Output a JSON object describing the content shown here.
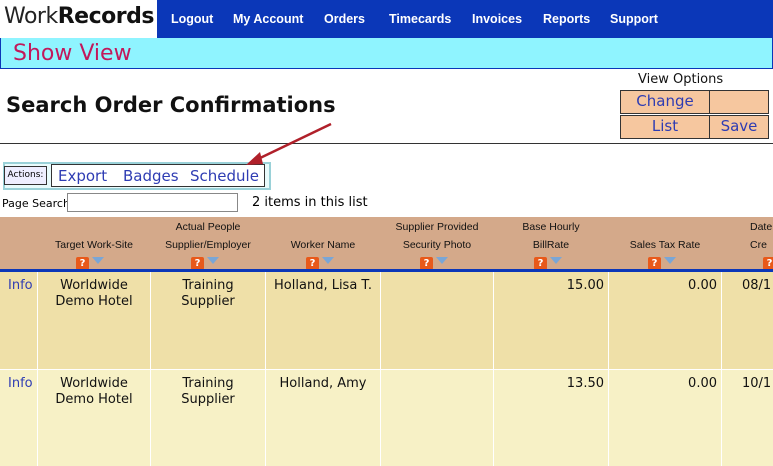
{
  "logo": {
    "work": "Work",
    "records": "Records"
  },
  "nav": [
    {
      "label": "Logout"
    },
    {
      "label": "My Account"
    },
    {
      "label": "Orders"
    },
    {
      "label": "Timecards"
    },
    {
      "label": "Invoices"
    },
    {
      "label": "Reports"
    },
    {
      "label": "Support"
    }
  ],
  "show_view": "Show View",
  "view_options": {
    "title": "View Options",
    "change": "Change",
    "list": "List",
    "save": "Save"
  },
  "page_title": "Search Order Confirmations",
  "actions": {
    "label": "Actions:",
    "export": "Export",
    "badges": "Badges",
    "schedule": "Schedule"
  },
  "page_search": {
    "label": "Page Search:",
    "value": "",
    "count_text": "2 items in this list"
  },
  "columns": [
    {
      "l1": "",
      "l2": "Target Work-Site"
    },
    {
      "l1": "Actual People",
      "l2": "Supplier/Employer"
    },
    {
      "l1": "",
      "l2": "Worker Name"
    },
    {
      "l1": "Supplier Provided",
      "l2": "Security Photo"
    },
    {
      "l1": "Base Hourly",
      "l2": "BillRate"
    },
    {
      "l1": "",
      "l2": "Sales Tax Rate"
    },
    {
      "l1": "Date",
      "l2": "Cre"
    }
  ],
  "rows": [
    {
      "info": "Info",
      "site_1": "Worldwide",
      "site_2": "Demo Hotel",
      "sup_1": "Training",
      "sup_2": "Supplier",
      "worker": "Holland, Lisa T.",
      "rate": "15.00",
      "tax": "0.00",
      "date": "08/1"
    },
    {
      "info": "Info",
      "site_1": "Worldwide",
      "site_2": "Demo Hotel",
      "sup_1": "Training",
      "sup_2": "Supplier",
      "worker": "Holland, Amy",
      "rate": "13.50",
      "tax": "0.00",
      "date": "10/1"
    }
  ],
  "colors": {
    "nav_bg": "#0b37b8",
    "show_view_bg": "#8ff4ff",
    "show_view_text": "#c2185b",
    "header_bg": "#d4a98a",
    "row1_bg": "#efe0a8",
    "row2_bg": "#f7f1c6",
    "button_bg": "#f6c79f",
    "link": "#2e3cb3"
  }
}
